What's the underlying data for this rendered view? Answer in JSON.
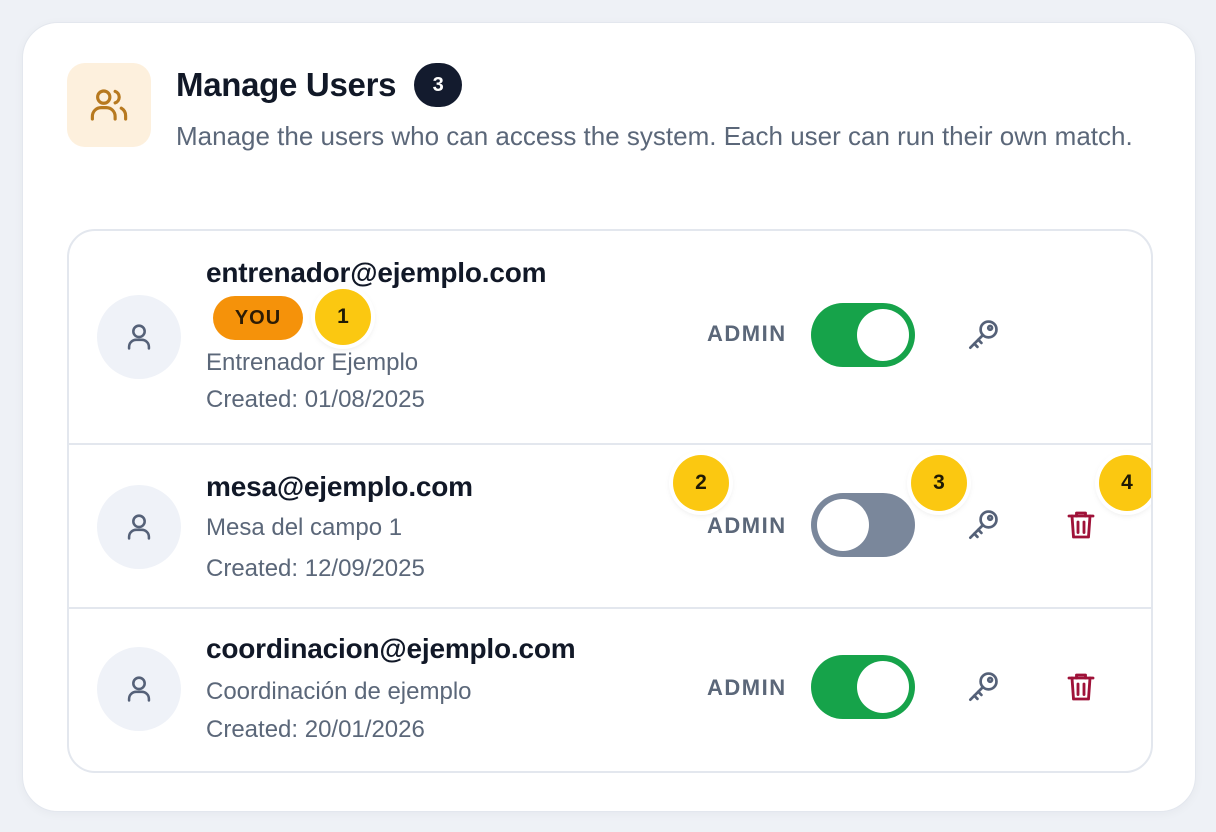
{
  "header": {
    "icon": "users-icon",
    "title": "Manage Users",
    "count": "3",
    "subtitle": "Manage the users who can access the system. Each user can run their own match."
  },
  "users": [
    {
      "email": "entrenador@ejemplo.com",
      "badge": "YOU",
      "name": "Entrenador Ejemplo",
      "created": "Created: 01/08/2025",
      "admin_label": "ADMIN",
      "admin": true,
      "deletable": false
    },
    {
      "email": "mesa@ejemplo.com",
      "name": "Mesa del campo 1",
      "created": "Created: 12/09/2025",
      "admin_label": "ADMIN",
      "admin": false,
      "deletable": true
    },
    {
      "email": "coordinacion@ejemplo.com",
      "name": "Coordinación de ejemplo",
      "created": "Created: 20/01/2026",
      "admin_label": "ADMIN",
      "admin": true,
      "deletable": true
    }
  ],
  "markers": [
    "1",
    "2",
    "3",
    "4"
  ],
  "colors": {
    "toggle_on": "#16a34a",
    "toggle_off": "#7a879b",
    "you_badge": "#f5920a",
    "delete": "#9f1239",
    "marker": "#fbc811",
    "header_icon": "#b7791f"
  }
}
